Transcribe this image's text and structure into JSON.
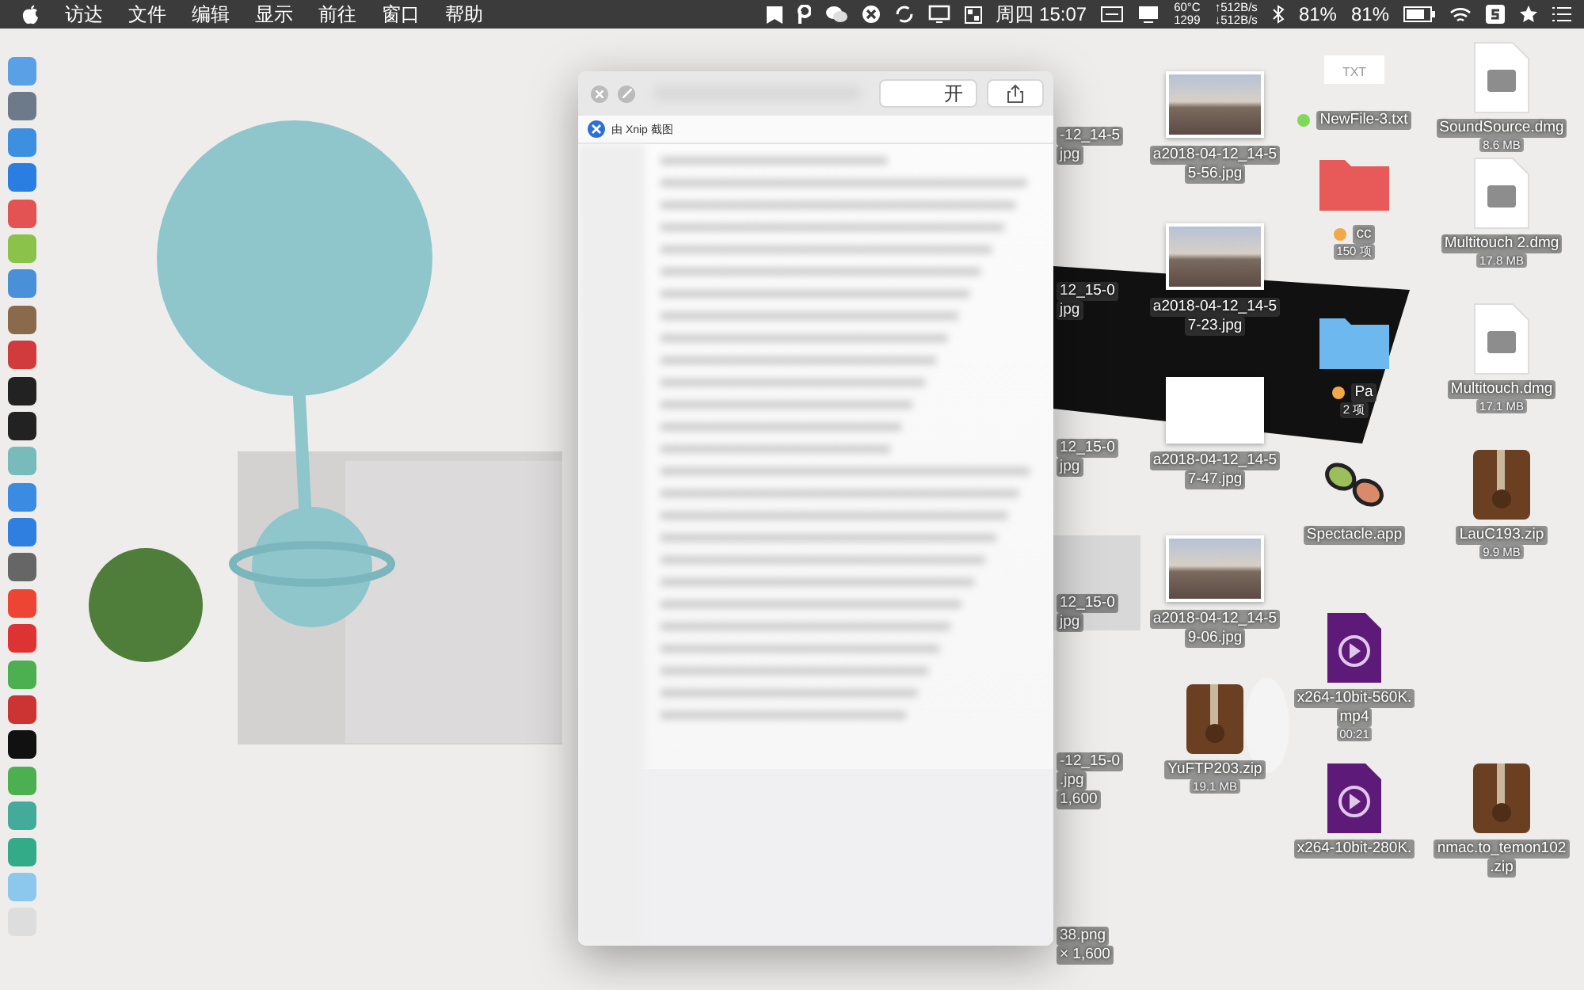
{
  "menu_bar": {
    "menus": [
      "访达",
      "文件",
      "编辑",
      "显示",
      "前往",
      "窗口",
      "帮助"
    ],
    "status": {
      "day_time": "周四 15:07",
      "temperature": "60°C",
      "fan": "1299",
      "upload": "↑512B/s",
      "download": "↓512B/s",
      "cpu": "81%",
      "battery": "81%"
    }
  },
  "preview_window": {
    "open_button": "开",
    "header": "由 Xnip 截图"
  },
  "cut_labels": [
    {
      "lines": [
        "-12_14-5",
        "jpg"
      ]
    },
    {
      "lines": [
        "12_15-0",
        "jpg"
      ]
    },
    {
      "lines": [
        "12_15-0",
        "jpg"
      ]
    },
    {
      "lines": [
        "12_15-0",
        "jpg"
      ]
    },
    {
      "lines": [
        "-12_15-0",
        ".jpg",
        "1,600"
      ]
    },
    {
      "lines": [
        "38.png",
        "× 1,600"
      ]
    }
  ],
  "desktop_columns": [
    [
      {
        "kind": "image",
        "lines": [
          "a2018-04-12_14-5",
          "5-56.jpg"
        ]
      },
      {
        "kind": "image",
        "lines": [
          "a2018-04-12_14-5",
          "7-23.jpg"
        ]
      },
      {
        "kind": "screenshot",
        "lines": [
          "a2018-04-12_14-5",
          "7-47.jpg"
        ]
      },
      {
        "kind": "image",
        "lines": [
          "a2018-04-12_14-5",
          "9-06.jpg"
        ]
      },
      {
        "kind": "zip",
        "lines": [
          "YuFTP203.zip"
        ],
        "sub": "19.1 MB"
      }
    ],
    [
      {
        "kind": "text",
        "badge": "TXT",
        "lines": [
          "NewFile-3.txt"
        ],
        "color": "#7ed957"
      },
      {
        "kind": "folder",
        "lines": [
          "cc"
        ],
        "sub": "150 项",
        "color": "#f0a848"
      },
      {
        "kind": "folder_blue",
        "lines": [
          "Pa"
        ],
        "sub": "2 项",
        "color": "#f0a848"
      },
      {
        "kind": "app",
        "lines": [
          "Spectacle.app"
        ]
      },
      {
        "kind": "video",
        "lines": [
          "x264-10bit-560K.",
          "mp4"
        ],
        "sub": "00:21"
      },
      {
        "kind": "video",
        "lines": [
          "x264-10bit-280K."
        ]
      }
    ],
    [
      {
        "kind": "disk",
        "lines": [
          "SoundSource.dmg"
        ],
        "sub": "8.6 MB"
      },
      {
        "kind": "disk",
        "lines": [
          "Multitouch 2.dmg"
        ],
        "sub": "17.8 MB"
      },
      {
        "kind": "disk",
        "lines": [
          "Multitouch.dmg"
        ],
        "sub": "17.1 MB"
      },
      {
        "kind": "zip",
        "lines": [
          "LauC193.zip"
        ],
        "sub": "9.9 MB"
      },
      {
        "kind": "zip",
        "lines": [
          "nmac.to_temon102",
          ".zip"
        ]
      }
    ]
  ]
}
